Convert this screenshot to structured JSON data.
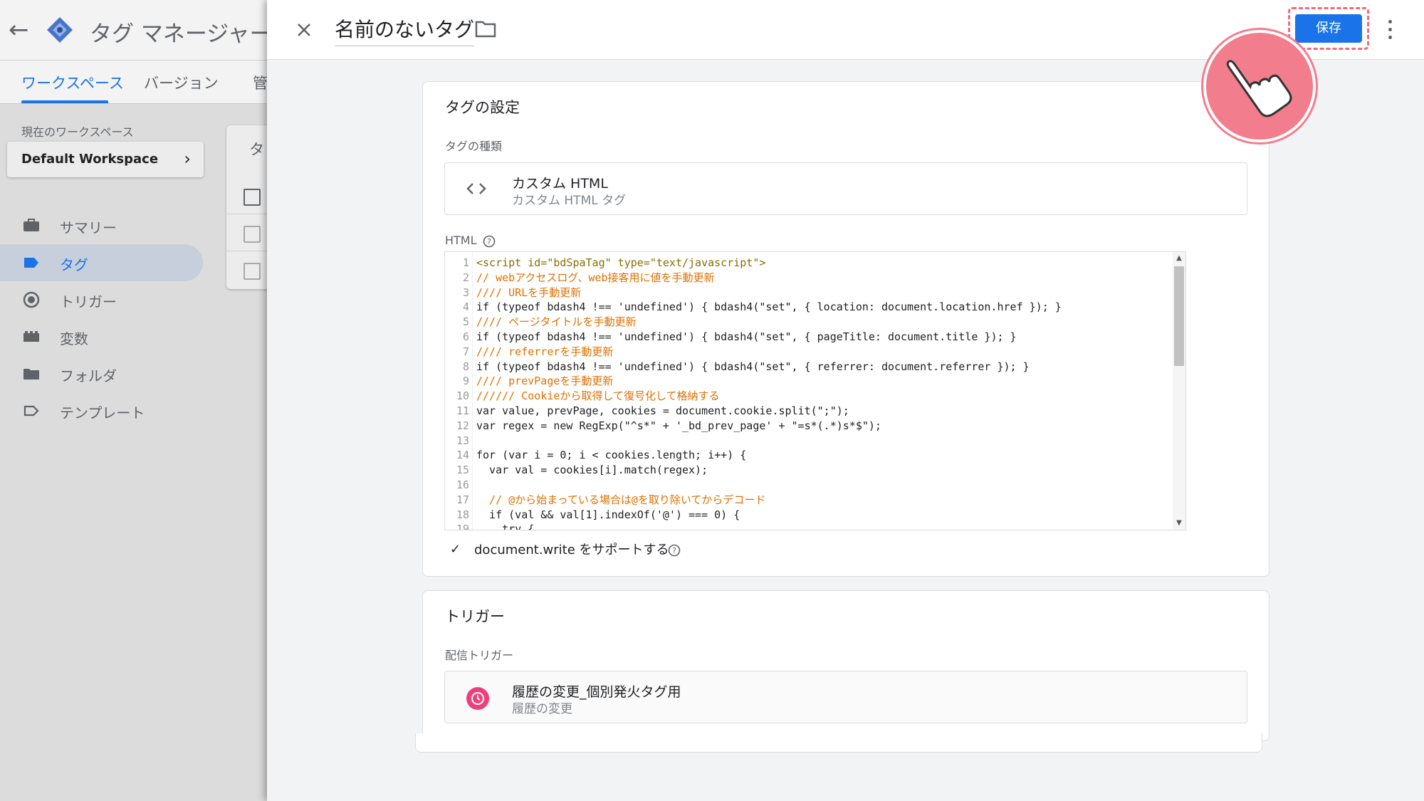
{
  "background": {
    "app_title": "タグ マネージャー",
    "tabs": [
      {
        "label": "ワークスペース",
        "active": true
      },
      {
        "label": "バージョン",
        "active": false
      },
      {
        "label": "管",
        "active": false
      }
    ],
    "workspace_label": "現在のワークスペース",
    "workspace_name": "Default Workspace",
    "nav_items": [
      {
        "label": "サマリー",
        "icon": "briefcase-icon",
        "active": false
      },
      {
        "label": "タグ",
        "icon": "tag-icon",
        "active": true
      },
      {
        "label": "トリガー",
        "icon": "trigger-icon",
        "active": false
      },
      {
        "label": "変数",
        "icon": "variables-icon",
        "active": false
      },
      {
        "label": "フォルダ",
        "icon": "folder-icon",
        "active": false
      },
      {
        "label": "テンプレート",
        "icon": "template-icon",
        "active": false
      }
    ],
    "table_header_partial": "タ"
  },
  "panel": {
    "tag_name": "名前のないタグ",
    "save_label": "保存",
    "tag_config": {
      "title": "タグの設定",
      "type_label": "タグの種類",
      "type_name": "カスタム HTML",
      "type_desc": "カスタム HTML タグ",
      "html_label": "HTML",
      "code_lines": [
        "<script id=\"bdSpaTag\" type=\"text/javascript\">",
        "// webアクセスログ、web接客用に値を手動更新",
        "//// URLを手動更新",
        "if (typeof bdash4 !== 'undefined') { bdash4(\"set\", { location: document.location.href }); }",
        "//// ページタイトルを手動更新",
        "if (typeof bdash4 !== 'undefined') { bdash4(\"set\", { pageTitle: document.title }); }",
        "//// referrerを手動更新",
        "if (typeof bdash4 !== 'undefined') { bdash4(\"set\", { referrer: document.referrer }); }",
        "//// prevPageを手動更新",
        "////// Cookieから取得して復号化して格納する",
        "var value, prevPage, cookies = document.cookie.split(\";\");",
        "var regex = new RegExp(\"^s*\" + '_bd_prev_page' + \"=s*(.*)s*$\");",
        "",
        "for (var i = 0; i < cookies.length; i++) {",
        "  var val = cookies[i].match(regex);",
        "",
        "  // @から始まっている場合は@を取り除いてからデコード",
        "  if (val && val[1].indexOf('@') === 0) {",
        "    try {"
      ],
      "document_write_label": "document.write をサポートする"
    },
    "trigger": {
      "title": "トリガー",
      "firing_label": "配信トリガー",
      "trigger_name": "履歴の変更_個別発火タグ用",
      "trigger_type": "履歴の変更"
    }
  },
  "colors": {
    "accent": "#1a73e8",
    "highlight": "#f06a7c",
    "trigger_icon": "#ec407a"
  }
}
